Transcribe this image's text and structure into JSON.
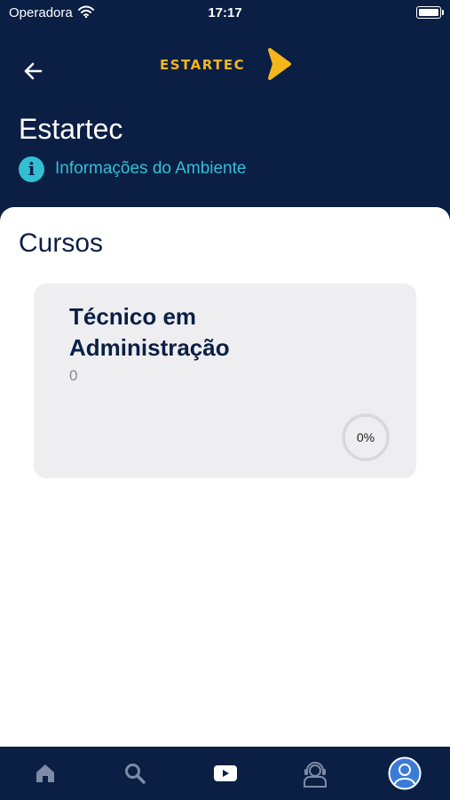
{
  "status_bar": {
    "carrier": "Operadora",
    "time": "17:17"
  },
  "header": {
    "logo_text": "ESTARTEC",
    "back_icon": "arrow-left-icon"
  },
  "page": {
    "title": "Estartec",
    "info_link": "Informações do Ambiente",
    "info_icon_glyph": "i"
  },
  "courses": {
    "section_title": "Cursos",
    "items": [
      {
        "name": "Técnico em Administração",
        "count": "0",
        "progress_label": "0%",
        "progress": 0
      }
    ]
  },
  "tab_bar": {
    "tabs": [
      {
        "icon": "home-icon",
        "active": false
      },
      {
        "icon": "search-icon",
        "active": false
      },
      {
        "icon": "video-play-icon",
        "active": true
      },
      {
        "icon": "support-headset-icon",
        "active": false
      },
      {
        "icon": "profile-avatar-icon",
        "active": false
      }
    ]
  },
  "colors": {
    "navy": "#0b1f45",
    "accent_cyan": "#33bfd3",
    "logo_yellow": "#f5b61c",
    "card_bg": "#eeeef1",
    "tab_inactive": "#7e8ba6",
    "profile_blue": "#3a7bd5"
  }
}
